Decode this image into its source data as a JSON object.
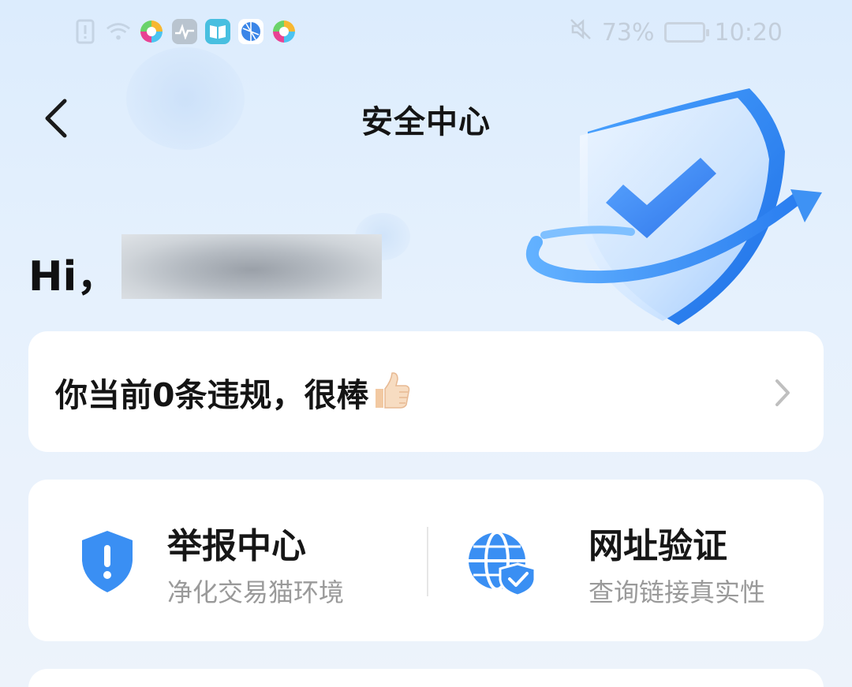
{
  "status_bar": {
    "battery_percent": "73%",
    "time": "10:20",
    "icons": [
      "sim-alert-icon",
      "wifi-icon",
      "app-icon",
      "pulse-icon",
      "book-icon",
      "browser-icon",
      "app-icon",
      "mute-icon",
      "battery-icon"
    ]
  },
  "header": {
    "title": "安全中心",
    "back_icon": "chevron-left-icon"
  },
  "greeting": {
    "prefix": "Hi，",
    "username_hidden": true
  },
  "violation": {
    "text": "你当前0条违规，很棒",
    "emoji": "thumbs-up-icon"
  },
  "services": [
    {
      "title": "举报中心",
      "subtitle": "净化交易猫环境",
      "icon": "shield-exclamation-icon"
    },
    {
      "title": "网址验证",
      "subtitle": "查询链接真实性",
      "icon": "globe-shield-check-icon"
    }
  ],
  "colors": {
    "accent_blue": "#3a8ff3",
    "background_top": "#dcecfd",
    "card_bg": "#ffffff",
    "subtitle_gray": "#9a9a9a"
  }
}
